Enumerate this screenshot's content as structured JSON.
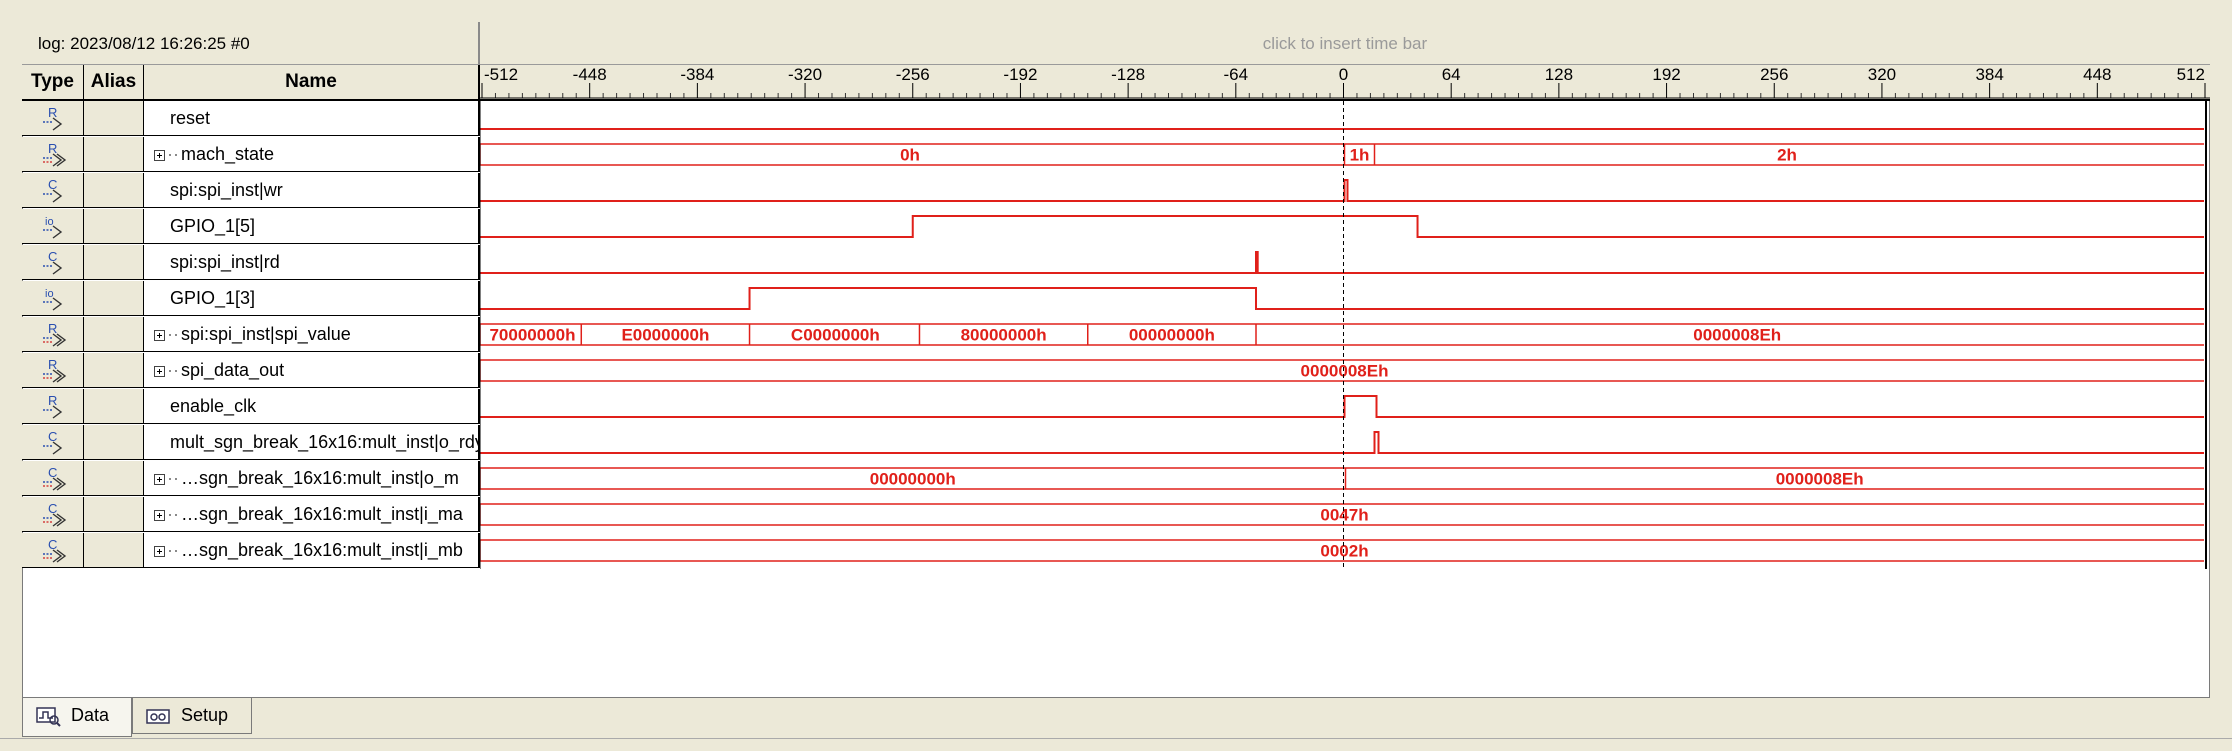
{
  "header": {
    "log_label": "log: 2023/08/12 16:26:25  #0",
    "time_bar_hint": "click to insert time bar"
  },
  "columns": {
    "type": "Type",
    "alias": "Alias",
    "name": "Name"
  },
  "ruler": {
    "ticks": [
      "-512",
      "-448",
      "-384",
      "-320",
      "-256",
      "-192",
      "-128",
      "-64",
      "0",
      "64",
      "128",
      "192",
      "256",
      "320",
      "384",
      "448",
      "512"
    ]
  },
  "signals": [
    {
      "name": "reset",
      "type_icon": "R",
      "bus": false,
      "bus_icon": false
    },
    {
      "name": "mach_state",
      "type_icon": "R",
      "bus": true,
      "bus_icon": true
    },
    {
      "name": "spi:spi_inst|wr",
      "type_icon": "C",
      "bus": false,
      "bus_icon": false
    },
    {
      "name": "GPIO_1[5]",
      "type_icon": "io",
      "bus": false,
      "bus_icon": false
    },
    {
      "name": "spi:spi_inst|rd",
      "type_icon": "C",
      "bus": false,
      "bus_icon": false
    },
    {
      "name": "GPIO_1[3]",
      "type_icon": "io",
      "bus": false,
      "bus_icon": false
    },
    {
      "name": "spi:spi_inst|spi_value",
      "type_icon": "R",
      "bus": true,
      "bus_icon": true
    },
    {
      "name": "spi_data_out",
      "type_icon": "R",
      "bus": true,
      "bus_icon": true
    },
    {
      "name": "enable_clk",
      "type_icon": "R",
      "bus": false,
      "bus_icon": false
    },
    {
      "name": "mult_sgn_break_16x16:mult_inst|o_rdy",
      "type_icon": "C",
      "bus": false,
      "bus_icon": false
    },
    {
      "name": "…sgn_break_16x16:mult_inst|o_m",
      "type_icon": "C",
      "bus": true,
      "bus_icon": true
    },
    {
      "name": "…sgn_break_16x16:mult_inst|i_ma",
      "type_icon": "C",
      "bus": true,
      "bus_icon": true
    },
    {
      "name": "…sgn_break_16x16:mult_inst|i_mb",
      "type_icon": "C",
      "bus": true,
      "bus_icon": true
    }
  ],
  "waves": {
    "mach_state": [
      "0h",
      "1h",
      "2h"
    ],
    "spi_value": [
      "70000000h",
      "E0000000h",
      "C0000000h",
      "80000000h",
      "00000000h",
      "0000008Eh"
    ],
    "spi_data_out": "0000008Eh",
    "o_m": [
      "00000000h",
      "0000008Eh"
    ],
    "i_ma": "0047h",
    "i_mb": "0002h"
  },
  "tabs": [
    {
      "label": "Data",
      "icon": "data-icon",
      "active": true
    },
    {
      "label": "Setup",
      "icon": "setup-icon",
      "active": false
    }
  ],
  "colors": {
    "waveform": "#e0201a",
    "chrome": "#ece9d8",
    "cursor": "#000000"
  }
}
